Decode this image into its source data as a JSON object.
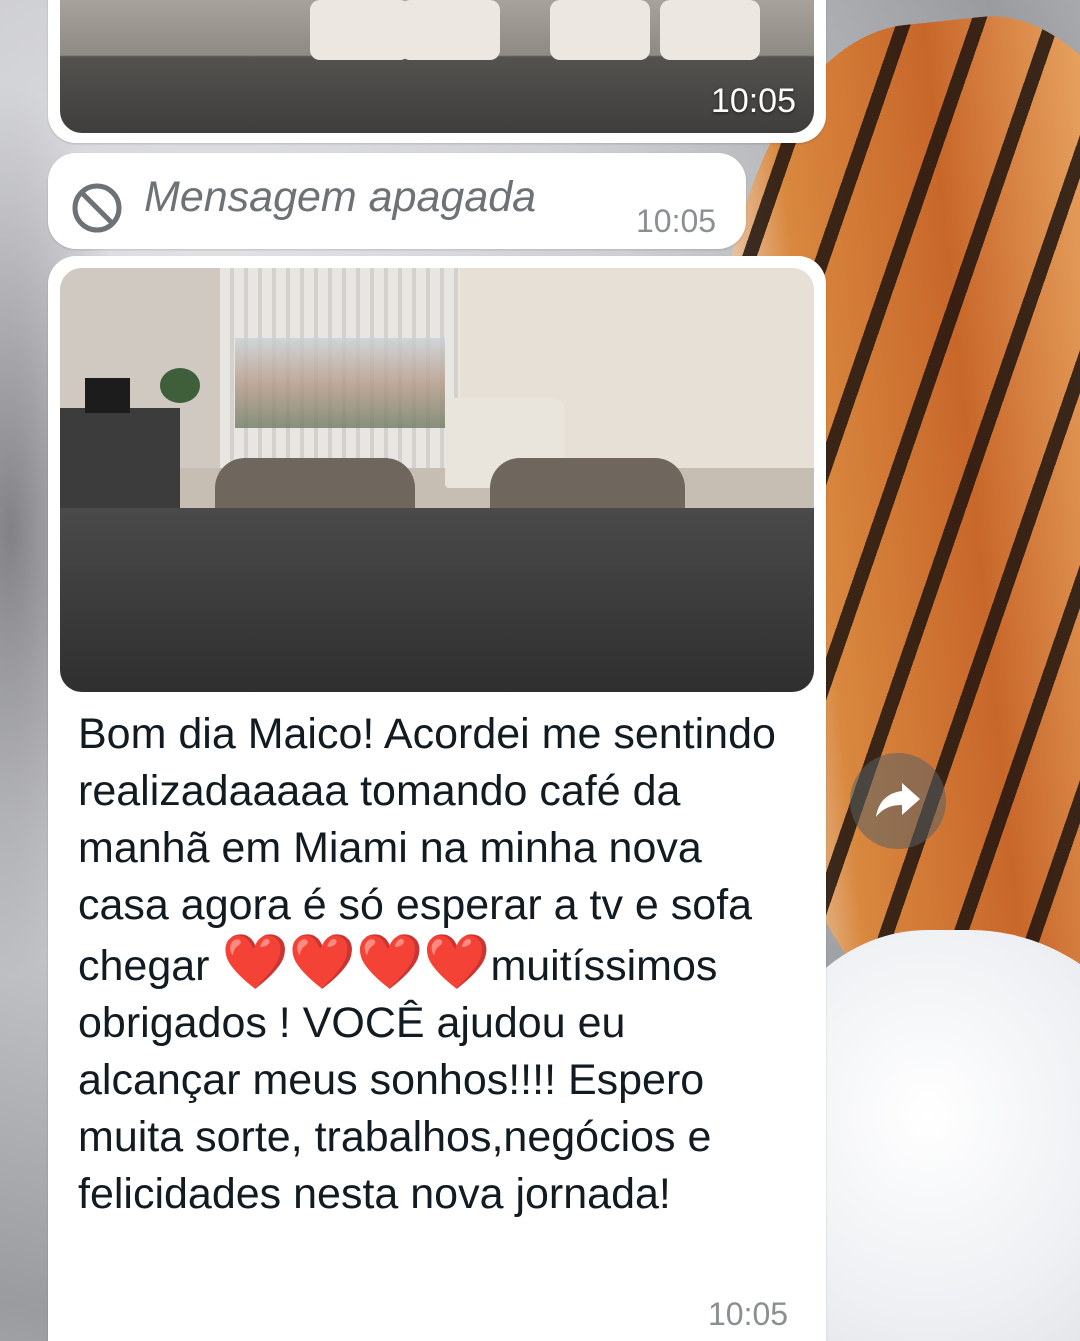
{
  "messages": [
    {
      "type": "image",
      "time": "10:05"
    },
    {
      "type": "deleted",
      "text": "Mensagem apagada",
      "time": "10:05",
      "icon": "blocked-icon"
    },
    {
      "type": "image-with-caption",
      "time": "10:05",
      "caption": {
        "part1": "Bom dia Maico! Acordei me sentindo realizadaaaaa tomando café da manhã em Miami na minha nova casa agora é só esperar a tv e sofa chegar ",
        "heart": "❤️",
        "part2": "muitíssimos obrigados ! VOCÊ ajudou eu alcançar meus sonhos!!!! Espero muita sorte, trabalhos,negócios e felicidades nesta nova jornada!"
      }
    }
  ],
  "forward": {
    "icon": "forward-icon"
  },
  "colors": {
    "bubble": "#ffffff",
    "text": "#111b21",
    "meta": "#8a8f92",
    "heart": "#e0201d"
  }
}
